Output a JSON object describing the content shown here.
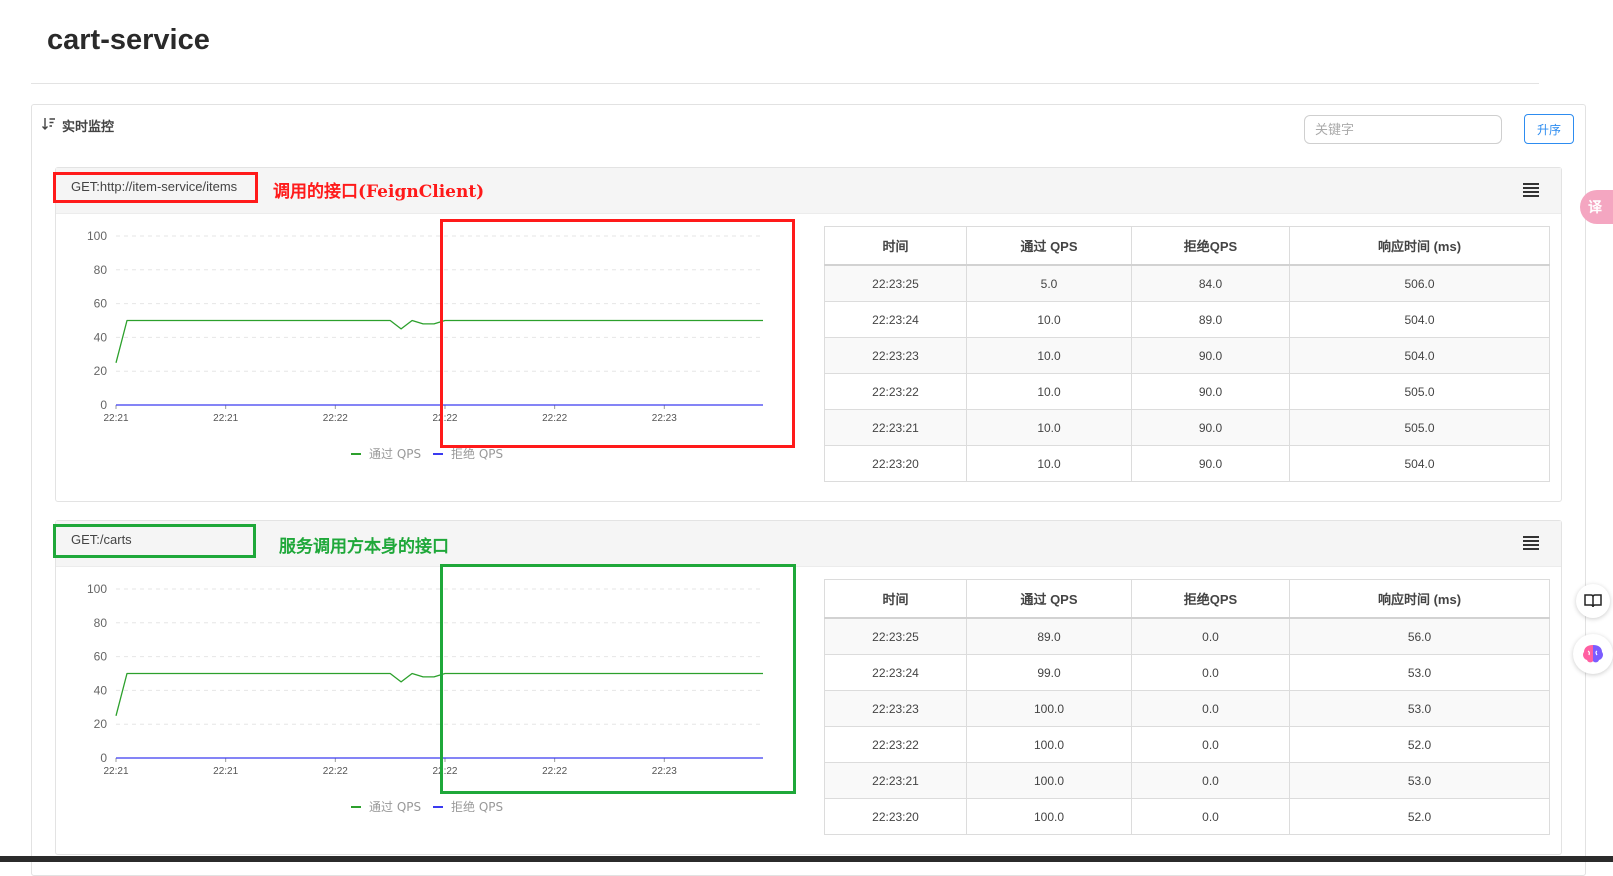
{
  "app": {
    "title": "cart-service"
  },
  "panel": {
    "title": "实时监控",
    "search_placeholder": "关键字",
    "sort_label": "升序"
  },
  "resources": [
    {
      "name": "GET:http://item-service/items",
      "annotation": "调用的接口(FeignClient)",
      "annotation_color": "#ff1a1a",
      "table_headers": [
        "时间",
        "通过 QPS",
        "拒绝QPS",
        "响应时间 (ms)"
      ],
      "table_rows": [
        [
          "22:23:25",
          "5.0",
          "84.0",
          "506.0"
        ],
        [
          "22:23:24",
          "10.0",
          "89.0",
          "504.0"
        ],
        [
          "22:23:23",
          "10.0",
          "90.0",
          "504.0"
        ],
        [
          "22:23:22",
          "10.0",
          "90.0",
          "505.0"
        ],
        [
          "22:23:21",
          "10.0",
          "90.0",
          "505.0"
        ],
        [
          "22:23:20",
          "10.0",
          "90.0",
          "504.0"
        ]
      ]
    },
    {
      "name": "GET:/carts",
      "annotation": "服务调用方本身的接口",
      "annotation_color": "#1fa83a",
      "table_headers": [
        "时间",
        "通过 QPS",
        "拒绝QPS",
        "响应时间 (ms)"
      ],
      "table_rows": [
        [
          "22:23:25",
          "89.0",
          "0.0",
          "56.0"
        ],
        [
          "22:23:24",
          "99.0",
          "0.0",
          "53.0"
        ],
        [
          "22:23:23",
          "100.0",
          "0.0",
          "53.0"
        ],
        [
          "22:23:22",
          "100.0",
          "0.0",
          "52.0"
        ],
        [
          "22:23:21",
          "100.0",
          "0.0",
          "53.0"
        ],
        [
          "22:23:20",
          "100.0",
          "0.0",
          "52.0"
        ]
      ]
    }
  ],
  "chart_data": [
    {
      "type": "line",
      "ylim": [
        0,
        100
      ],
      "yticks": [
        0,
        20,
        40,
        60,
        80,
        100
      ],
      "x": [
        0,
        2,
        4,
        6,
        8,
        10,
        12,
        14,
        16,
        18,
        20,
        22,
        24,
        26,
        28,
        30,
        32,
        34,
        36,
        38,
        40,
        42,
        44,
        46,
        48,
        50,
        52,
        54,
        56,
        58,
        60,
        62,
        64,
        66,
        68,
        70,
        72,
        74,
        76,
        78,
        80,
        82,
        84,
        86,
        88,
        90,
        92,
        94,
        96,
        98,
        100,
        102,
        104,
        106,
        108,
        110,
        112,
        114,
        116,
        118
      ],
      "xtick_labels": [
        "22:21",
        "22:21",
        "22:22",
        "22:22",
        "22:22",
        "22:23"
      ],
      "xtick_positions": [
        0,
        20,
        40,
        60,
        80,
        100
      ],
      "legend": [
        "通过 QPS",
        "拒绝 QPS"
      ],
      "series": [
        {
          "name": "通过 QPS",
          "color": "#2ca02c",
          "values": [
            25,
            50,
            50,
            50,
            50,
            50,
            50,
            50,
            50,
            50,
            50,
            50,
            50,
            50,
            50,
            50,
            50,
            50,
            50,
            50,
            50,
            50,
            50,
            50,
            50,
            50,
            45,
            50,
            48,
            48,
            50,
            50,
            50,
            50,
            50,
            50,
            50,
            50,
            50,
            50,
            50,
            50,
            50,
            50,
            50,
            50,
            50,
            50,
            50,
            50,
            50,
            50,
            50,
            50,
            50,
            50,
            50,
            50,
            50,
            50
          ]
        },
        {
          "name": "拒绝 QPS",
          "color": "#3a3af0",
          "values": [
            0,
            0,
            0,
            0,
            0,
            0,
            0,
            0,
            0,
            0,
            0,
            0,
            0,
            0,
            0,
            0,
            0,
            0,
            0,
            0,
            0,
            0,
            0,
            0,
            0,
            0,
            0,
            0,
            0,
            0,
            0,
            0,
            0,
            0,
            0,
            0,
            0,
            0,
            0,
            0,
            0,
            0,
            0,
            0,
            0,
            0,
            0,
            0,
            0,
            0,
            0,
            0,
            0,
            0,
            0,
            0,
            0,
            0,
            0,
            0
          ]
        }
      ]
    },
    {
      "type": "line",
      "ylim": [
        0,
        100
      ],
      "yticks": [
        0,
        20,
        40,
        60,
        80,
        100
      ],
      "x": [
        0,
        2,
        4,
        6,
        8,
        10,
        12,
        14,
        16,
        18,
        20,
        22,
        24,
        26,
        28,
        30,
        32,
        34,
        36,
        38,
        40,
        42,
        44,
        46,
        48,
        50,
        52,
        54,
        56,
        58,
        60,
        62,
        64,
        66,
        68,
        70,
        72,
        74,
        76,
        78,
        80,
        82,
        84,
        86,
        88,
        90,
        92,
        94,
        96,
        98,
        100,
        102,
        104,
        106,
        108,
        110,
        112,
        114,
        116,
        118
      ],
      "xtick_labels": [
        "22:21",
        "22:21",
        "22:22",
        "22:22",
        "22:22",
        "22:23"
      ],
      "xtick_positions": [
        0,
        20,
        40,
        60,
        80,
        100
      ],
      "legend": [
        "通过 QPS",
        "拒绝 QPS"
      ],
      "series": [
        {
          "name": "通过 QPS",
          "color": "#2ca02c",
          "values": [
            25,
            50,
            50,
            50,
            50,
            50,
            50,
            50,
            50,
            50,
            50,
            50,
            50,
            50,
            50,
            50,
            50,
            50,
            50,
            50,
            50,
            50,
            50,
            50,
            50,
            50,
            45,
            50,
            48,
            48,
            50,
            50,
            50,
            50,
            50,
            50,
            50,
            50,
            50,
            50,
            50,
            50,
            50,
            50,
            50,
            50,
            50,
            50,
            50,
            50,
            50,
            50,
            50,
            50,
            50,
            50,
            50,
            50,
            50,
            50
          ]
        },
        {
          "name": "拒绝 QPS",
          "color": "#3a3af0",
          "values": [
            0,
            0,
            0,
            0,
            0,
            0,
            0,
            0,
            0,
            0,
            0,
            0,
            0,
            0,
            0,
            0,
            0,
            0,
            0,
            0,
            0,
            0,
            0,
            0,
            0,
            0,
            0,
            0,
            0,
            0,
            0,
            0,
            0,
            0,
            0,
            0,
            0,
            0,
            0,
            0,
            0,
            0,
            0,
            0,
            0,
            0,
            0,
            0,
            0,
            0,
            0,
            0,
            0,
            0,
            0,
            0,
            0,
            0,
            0,
            0
          ]
        }
      ]
    }
  ]
}
